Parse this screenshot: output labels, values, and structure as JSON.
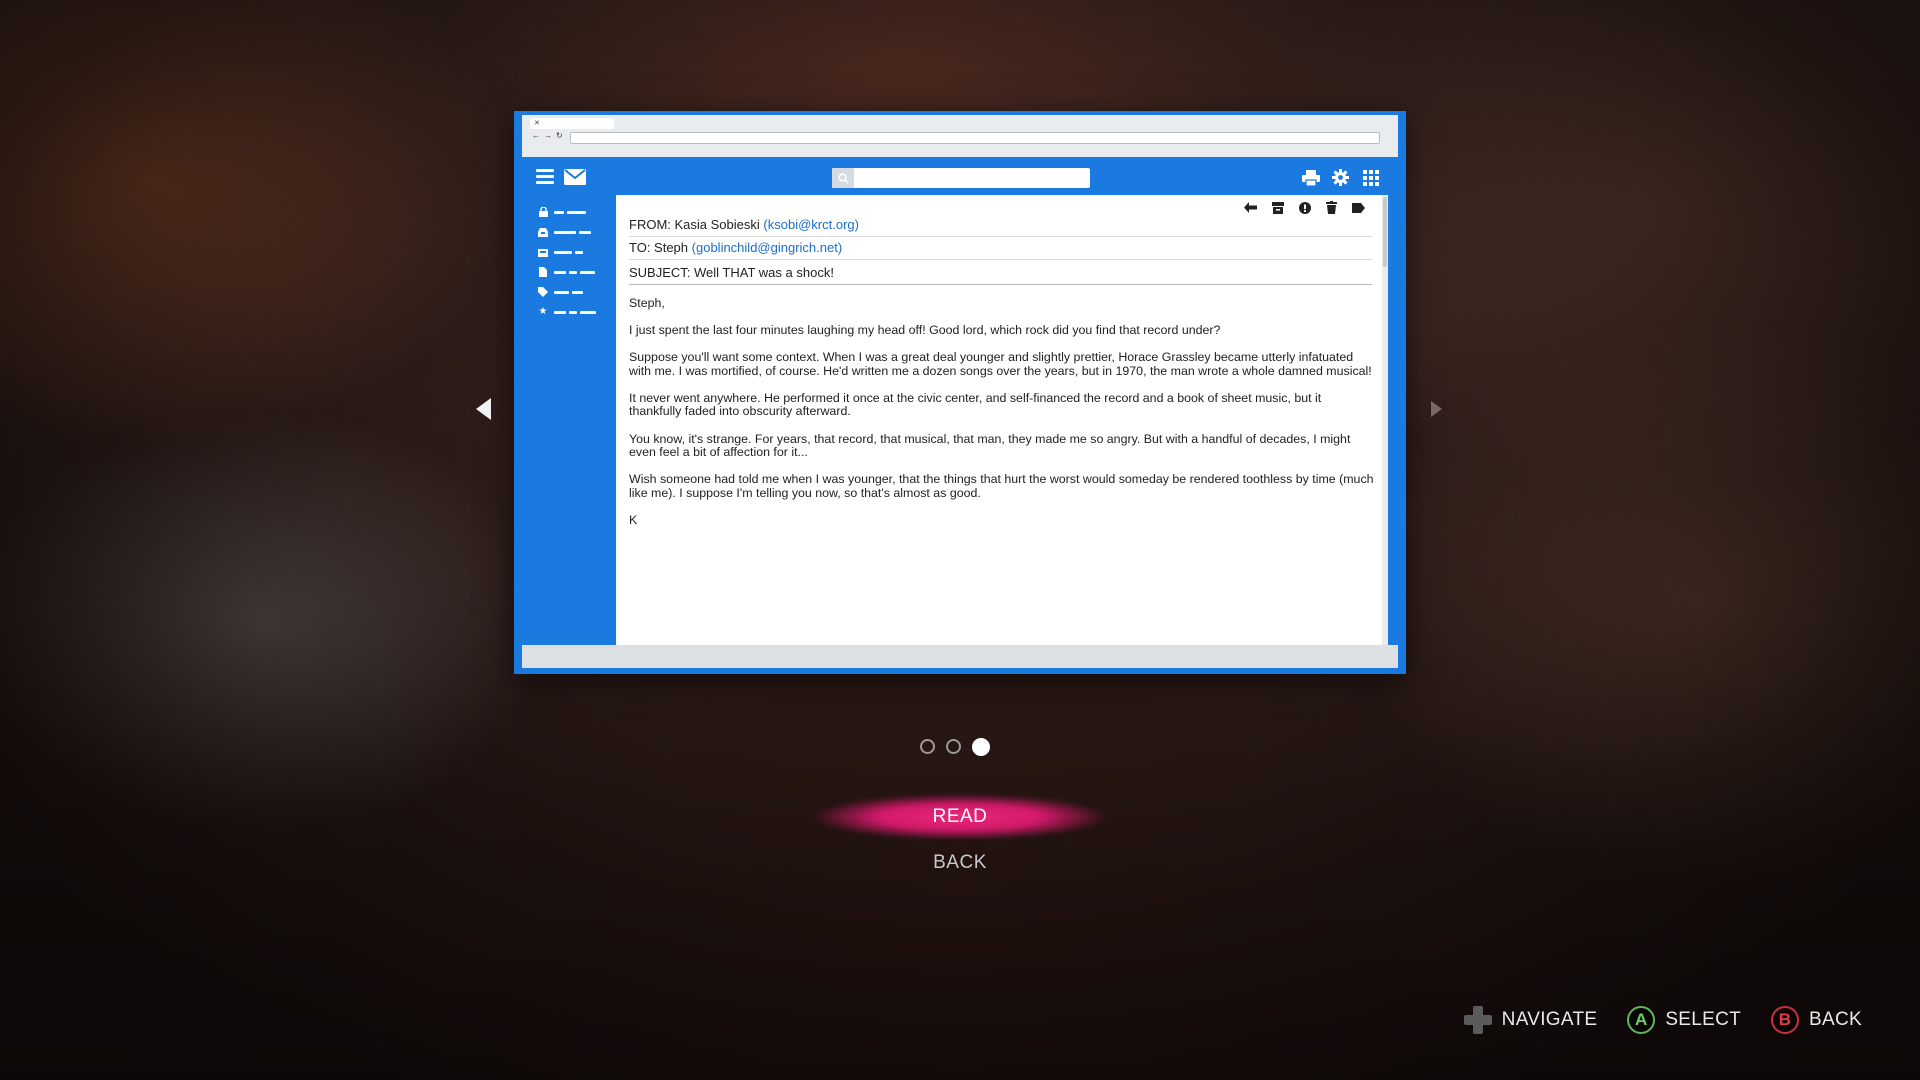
{
  "email": {
    "from_label": "FROM: ",
    "from_name": "Kasia Sobieski",
    "from_address": "(ksobi@krct.org)",
    "to_label": "TO: ",
    "to_name": "Steph",
    "to_address": "(goblinchild@gingrich.net)",
    "subject": "SUBJECT: Well THAT was a shock!",
    "body": [
      "Steph,",
      "I just spent the last four minutes laughing my head off! Good lord, which rock did you find that record under?",
      "Suppose you'll want some context. When I was a great deal younger and slightly prettier, Horace Grassley became utterly infatuated with me. I was mortified, of course. He'd written me a dozen songs over the years, but in 1970, the man wrote a whole damned musical!",
      "It never went anywhere. He performed it once at the civic center, and self-financed the record and a book of sheet music, but it thankfully faded into obscurity afterward.",
      "You know, it's strange. For years, that record, that musical, that man, they made me so angry. But with a handful of decades, I might even feel a bit of affection for it...",
      "Wish someone had told me when I was younger, that the things that hurt the worst would someday be rendered toothless by time (much like me). I suppose I'm telling you now, so that's almost as good.",
      "K"
    ]
  },
  "menu": {
    "read_label": "READ",
    "back_label": "BACK"
  },
  "carousel": {
    "page_count": 3,
    "current_page": 3
  },
  "hints": {
    "navigate_label": "NAVIGATE",
    "select_button": "A",
    "select_label": "SELECT",
    "back_button": "B",
    "back_label": "BACK"
  },
  "colors": {
    "mail_blue": "#1a7ae0",
    "highlight_pink": "#d3196a",
    "link_blue": "#1a6fc9",
    "a_button_green": "#5fb65a",
    "b_button_red": "#c8303a"
  },
  "icons": {
    "app_bar": [
      "menu-icon",
      "mail-icon",
      "search-icon",
      "print-icon",
      "gear-icon",
      "apps-grid-icon"
    ],
    "message_toolbar": [
      "reply-icon",
      "archive-icon",
      "report-icon",
      "trash-icon",
      "label-icon"
    ],
    "sidebar": [
      "lock-icon",
      "inbox-icon",
      "drafts-icon",
      "document-icon",
      "tag-icon",
      "star-icon"
    ]
  }
}
